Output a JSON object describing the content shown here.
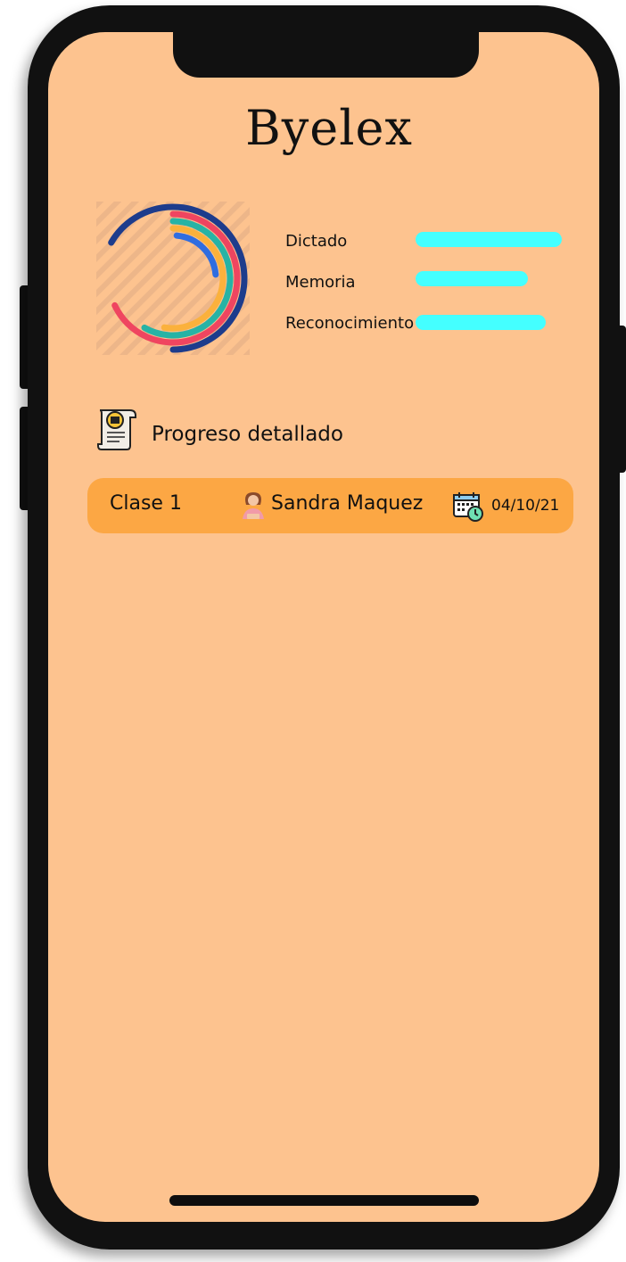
{
  "app": {
    "title": "Byelex"
  },
  "skills": [
    {
      "label": "Dictado",
      "progress": 1.0,
      "color": "#44ffff"
    },
    {
      "label": "Memoria",
      "progress": 0.77,
      "color": "#44ffff"
    },
    {
      "label": "Reconocimiento",
      "progress": 0.89,
      "color": "#44ffff"
    }
  ],
  "ring_chart": {
    "rings": [
      {
        "color": "#1d3c8c"
      },
      {
        "color": "#ef4560"
      },
      {
        "color": "#27b3a5"
      },
      {
        "color": "#fbb13c"
      },
      {
        "color": "#2f6de0"
      }
    ]
  },
  "section": {
    "title": "Progreso detallado",
    "icon": "certificate-icon"
  },
  "classes": [
    {
      "name": "Clase 1",
      "teacher": "Sandra Maquez",
      "teacher_icon": "teacher-avatar-icon",
      "date_icon": "calendar-clock-icon",
      "date": "04/10/21"
    }
  ],
  "colors": {
    "background": "#fdc38f",
    "row_background": "#fca744",
    "frame": "#111111"
  }
}
